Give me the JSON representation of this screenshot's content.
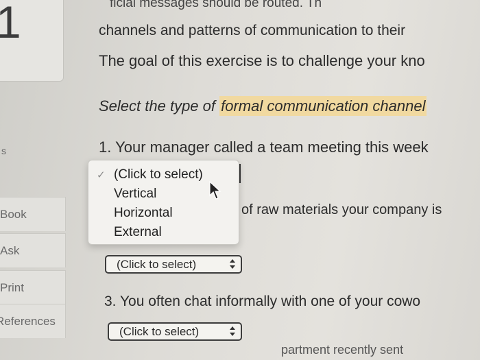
{
  "sidebar": {
    "tile_number": "1",
    "dot": "s",
    "items": [
      {
        "label": "Book"
      },
      {
        "label": "Ask"
      },
      {
        "label": "Print"
      },
      {
        "label": "References"
      }
    ]
  },
  "content": {
    "top_line_1": "ficial messages should be routed. Th",
    "top_line_2": "channels and patterns of communication to their",
    "goal": "The goal of this exercise is to challenge your kno",
    "instruction_prefix": "Select the type of ",
    "instruction_highlight": "formal communication channel",
    "question_1": "1. Your manager called a team meeting this week",
    "question_2_tail": "of raw materials your company is",
    "question_3": "3. You often chat informally with one of your cowo",
    "question_4_tail": "partment recently sent"
  },
  "dropdown": {
    "check_icon": "check-icon",
    "options": [
      {
        "label": "(Click to select)",
        "selected": true
      },
      {
        "label": "Vertical"
      },
      {
        "label": "Horizontal"
      },
      {
        "label": "External"
      }
    ]
  },
  "selects": {
    "q2_value": "(Click to select)",
    "q3_value": "(Click to select)"
  },
  "colors": {
    "highlight": "#f1d9a0",
    "background": "#e0dfda"
  }
}
